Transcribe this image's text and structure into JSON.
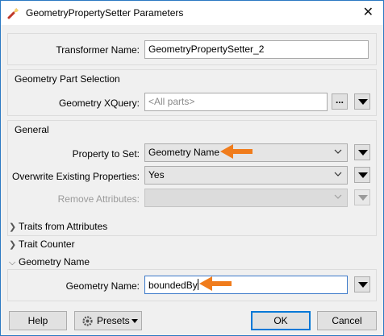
{
  "window": {
    "title": "GeometryPropertySetter Parameters",
    "icon": "transformer-icon",
    "close_glyph": "✕"
  },
  "transformer_name": {
    "label": "Transformer Name:",
    "value": "GeometryPropertySetter_2"
  },
  "geometry_part_selection": {
    "title": "Geometry Part Selection",
    "xquery_label": "Geometry XQuery:",
    "xquery_placeholder": "<All parts>",
    "ellipsis_label": "..."
  },
  "general": {
    "title": "General",
    "property_label": "Property to Set:",
    "property_value": "Geometry Name",
    "overwrite_label": "Overwrite Existing Properties:",
    "overwrite_value": "Yes",
    "remove_label": "Remove Attributes:",
    "remove_value": ""
  },
  "sections": {
    "traits_from_attributes": "Traits from Attributes",
    "trait_counter": "Trait Counter",
    "geometry_name": "Geometry Name"
  },
  "geometry_name": {
    "label": "Geometry Name:",
    "value": "boundedBy"
  },
  "buttons": {
    "help": "Help",
    "presets": "Presets",
    "ok": "OK",
    "cancel": "Cancel"
  },
  "colors": {
    "annotation_arrow": "#f07c1c",
    "focus_border": "#3b79c9"
  }
}
